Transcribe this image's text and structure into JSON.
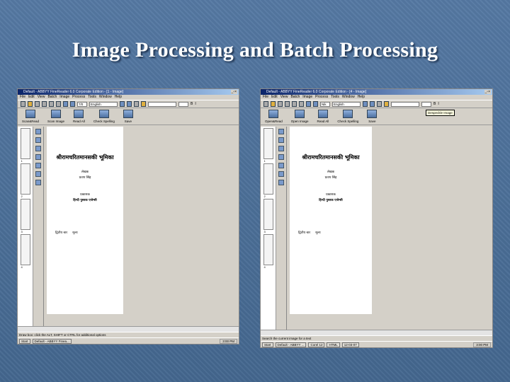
{
  "slide": {
    "title": "Image Processing and Batch Processing"
  },
  "windows": [
    {
      "title": "Default - ABBYY FineReader 6.0 Corporate Edition - [1 - Image]",
      "menu": [
        "File",
        "Edit",
        "View",
        "Batch",
        "Image",
        "Process",
        "Tools",
        "Window",
        "Help"
      ],
      "language": "English",
      "zoom": "7/0",
      "big_buttons": [
        "Scan&Read",
        "Scan Image",
        "Read All",
        "Check Spelling",
        "Save"
      ],
      "tooltip": "",
      "page": {
        "heading": "श्रीरामचरितमानसकी भूमिका",
        "author_label": "लेखक",
        "author": "प्रताप सिंह",
        "publisher_label": "प्रकाशक",
        "publisher": "हिन्दी पुस्तक एजेन्सी",
        "edition": "द्वितीय बार",
        "price": "मूल्य"
      },
      "thumb_labels": [
        "1",
        "2",
        "3",
        "4"
      ],
      "status": "Draw box: click the ALT, SHIFT or CTRL for additional options",
      "taskbar": {
        "start": "Start",
        "items": [
          "Default - ABBYY Finea..."
        ],
        "clock": "3:00 PM"
      }
    },
    {
      "title": "Default - ABBYY FineReader 6.0 Corporate Edition - [4 - Image]",
      "menu": [
        "File",
        "Edit",
        "View",
        "Batch",
        "Image",
        "Process",
        "Tools",
        "Window",
        "Help"
      ],
      "language": "English",
      "zoom": "Nik",
      "big_buttons": [
        "Open&Read",
        "Open Image",
        "Read All",
        "Check Spelling",
        "Save"
      ],
      "tooltip": "Despeckle Image",
      "page": {
        "heading": "श्रीरामचरितमानसकी भूमिका",
        "author_label": "लेखक",
        "author": "प्रताप सिंह",
        "publisher_label": "प्रकाशक",
        "publisher": "हिन्दी पुस्तक एजेन्सी",
        "edition": "द्वितीय बार",
        "price": "मूल्य"
      },
      "thumb_labels": [
        "1",
        "2",
        "3",
        "4"
      ],
      "status": "Search the current image for a text",
      "taskbar": {
        "start": "Start",
        "items": [
          "Default - ABBYY ...",
          "Corel 12",
          "HTML",
          "12-03-07"
        ],
        "clock": "3:00 PM"
      }
    }
  ]
}
